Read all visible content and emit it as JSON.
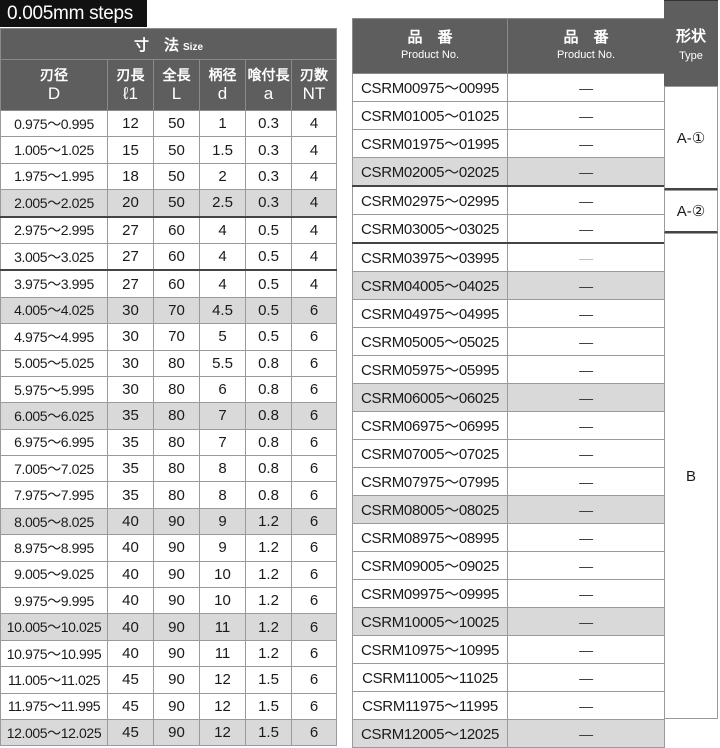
{
  "steps_label": "0.005mm steps",
  "size_table": {
    "group_header": {
      "jp": "寸　法",
      "en": "Size"
    },
    "columns": [
      {
        "jp": "刃径",
        "en": "D"
      },
      {
        "jp": "刃長",
        "en": "ℓ1"
      },
      {
        "jp": "全長",
        "en": "L"
      },
      {
        "jp": "柄径",
        "en": "d"
      },
      {
        "jp": "喰付長",
        "en": "a"
      },
      {
        "jp": "刃数",
        "en": "NT"
      }
    ],
    "rows": [
      {
        "D": "0.975～0.995",
        "l1": "12",
        "L": "50",
        "d": "1",
        "a": "0.3",
        "NT": "4",
        "shade": false,
        "group_end": false
      },
      {
        "D": "1.005～1.025",
        "l1": "15",
        "L": "50",
        "d": "1.5",
        "a": "0.3",
        "NT": "4",
        "shade": false,
        "group_end": false
      },
      {
        "D": "1.975～1.995",
        "l1": "18",
        "L": "50",
        "d": "2",
        "a": "0.3",
        "NT": "4",
        "shade": false,
        "group_end": false
      },
      {
        "D": "2.005～2.025",
        "l1": "20",
        "L": "50",
        "d": "2.5",
        "a": "0.3",
        "NT": "4",
        "shade": true,
        "group_end": true
      },
      {
        "D": "2.975～2.995",
        "l1": "27",
        "L": "60",
        "d": "4",
        "a": "0.5",
        "NT": "4",
        "shade": false,
        "group_end": false
      },
      {
        "D": "3.005～3.025",
        "l1": "27",
        "L": "60",
        "d": "4",
        "a": "0.5",
        "NT": "4",
        "shade": false,
        "group_end": true
      },
      {
        "D": "3.975～3.995",
        "l1": "27",
        "L": "60",
        "d": "4",
        "a": "0.5",
        "NT": "4",
        "shade": false,
        "group_end": false
      },
      {
        "D": "4.005～4.025",
        "l1": "30",
        "L": "70",
        "d": "4.5",
        "a": "0.5",
        "NT": "6",
        "shade": true,
        "group_end": false
      },
      {
        "D": "4.975～4.995",
        "l1": "30",
        "L": "70",
        "d": "5",
        "a": "0.5",
        "NT": "6",
        "shade": false,
        "group_end": false
      },
      {
        "D": "5.005～5.025",
        "l1": "30",
        "L": "80",
        "d": "5.5",
        "a": "0.8",
        "NT": "6",
        "shade": false,
        "group_end": false
      },
      {
        "D": "5.975～5.995",
        "l1": "30",
        "L": "80",
        "d": "6",
        "a": "0.8",
        "NT": "6",
        "shade": false,
        "group_end": false
      },
      {
        "D": "6.005～6.025",
        "l1": "35",
        "L": "80",
        "d": "7",
        "a": "0.8",
        "NT": "6",
        "shade": true,
        "group_end": false
      },
      {
        "D": "6.975～6.995",
        "l1": "35",
        "L": "80",
        "d": "7",
        "a": "0.8",
        "NT": "6",
        "shade": false,
        "group_end": false
      },
      {
        "D": "7.005～7.025",
        "l1": "35",
        "L": "80",
        "d": "8",
        "a": "0.8",
        "NT": "6",
        "shade": false,
        "group_end": false
      },
      {
        "D": "7.975～7.995",
        "l1": "35",
        "L": "80",
        "d": "8",
        "a": "0.8",
        "NT": "6",
        "shade": false,
        "group_end": false
      },
      {
        "D": "8.005～8.025",
        "l1": "40",
        "L": "90",
        "d": "9",
        "a": "1.2",
        "NT": "6",
        "shade": true,
        "group_end": false
      },
      {
        "D": "8.975～8.995",
        "l1": "40",
        "L": "90",
        "d": "9",
        "a": "1.2",
        "NT": "6",
        "shade": false,
        "group_end": false
      },
      {
        "D": "9.005～9.025",
        "l1": "40",
        "L": "90",
        "d": "10",
        "a": "1.2",
        "NT": "6",
        "shade": false,
        "group_end": false
      },
      {
        "D": "9.975～9.995",
        "l1": "40",
        "L": "90",
        "d": "10",
        "a": "1.2",
        "NT": "6",
        "shade": false,
        "group_end": false
      },
      {
        "D": "10.005～10.025",
        "l1": "40",
        "L": "90",
        "d": "11",
        "a": "1.2",
        "NT": "6",
        "shade": true,
        "group_end": false
      },
      {
        "D": "10.975～10.995",
        "l1": "40",
        "L": "90",
        "d": "11",
        "a": "1.2",
        "NT": "6",
        "shade": false,
        "group_end": false
      },
      {
        "D": "11.005～11.025",
        "l1": "45",
        "L": "90",
        "d": "12",
        "a": "1.5",
        "NT": "6",
        "shade": false,
        "group_end": false
      },
      {
        "D": "11.975～11.995",
        "l1": "45",
        "L": "90",
        "d": "12",
        "a": "1.5",
        "NT": "6",
        "shade": false,
        "group_end": false
      },
      {
        "D": "12.005～12.025",
        "l1": "45",
        "L": "90",
        "d": "12",
        "a": "1.5",
        "NT": "6",
        "shade": true,
        "group_end": false
      }
    ]
  },
  "product_table": {
    "columns": [
      {
        "jp": "品　番",
        "en": "Product No."
      },
      {
        "jp": "品　番",
        "en": "Product No."
      }
    ],
    "rows": [
      {
        "no1": "CSRM00975～00995",
        "no2": "—",
        "shade": false,
        "group_end": false,
        "faint": false
      },
      {
        "no1": "CSRM01005～01025",
        "no2": "—",
        "shade": false,
        "group_end": false,
        "faint": false
      },
      {
        "no1": "CSRM01975～01995",
        "no2": "—",
        "shade": false,
        "group_end": false,
        "faint": false
      },
      {
        "no1": "CSRM02005～02025",
        "no2": "—",
        "shade": true,
        "group_end": true,
        "faint": false
      },
      {
        "no1": "CSRM02975～02995",
        "no2": "—",
        "shade": false,
        "group_end": false,
        "faint": false
      },
      {
        "no1": "CSRM03005～03025",
        "no2": "—",
        "shade": false,
        "group_end": true,
        "faint": false
      },
      {
        "no1": "CSRM03975～03995",
        "no2": "—",
        "shade": false,
        "group_end": false,
        "faint": true
      },
      {
        "no1": "CSRM04005～04025",
        "no2": "—",
        "shade": true,
        "group_end": false,
        "faint": false
      },
      {
        "no1": "CSRM04975～04995",
        "no2": "—",
        "shade": false,
        "group_end": false,
        "faint": false
      },
      {
        "no1": "CSRM05005～05025",
        "no2": "—",
        "shade": false,
        "group_end": false,
        "faint": false
      },
      {
        "no1": "CSRM05975～05995",
        "no2": "—",
        "shade": false,
        "group_end": false,
        "faint": false
      },
      {
        "no1": "CSRM06005～06025",
        "no2": "—",
        "shade": true,
        "group_end": false,
        "faint": false
      },
      {
        "no1": "CSRM06975～06995",
        "no2": "—",
        "shade": false,
        "group_end": false,
        "faint": false
      },
      {
        "no1": "CSRM07005～07025",
        "no2": "—",
        "shade": false,
        "group_end": false,
        "faint": false
      },
      {
        "no1": "CSRM07975～07995",
        "no2": "—",
        "shade": false,
        "group_end": false,
        "faint": false
      },
      {
        "no1": "CSRM08005～08025",
        "no2": "—",
        "shade": true,
        "group_end": false,
        "faint": false
      },
      {
        "no1": "CSRM08975～08995",
        "no2": "—",
        "shade": false,
        "group_end": false,
        "faint": false
      },
      {
        "no1": "CSRM09005～09025",
        "no2": "—",
        "shade": false,
        "group_end": false,
        "faint": false
      },
      {
        "no1": "CSRM09975～09995",
        "no2": "—",
        "shade": false,
        "group_end": false,
        "faint": false
      },
      {
        "no1": "CSRM10005～10025",
        "no2": "—",
        "shade": true,
        "group_end": false,
        "faint": false
      },
      {
        "no1": "CSRM10975～10995",
        "no2": "—",
        "shade": false,
        "group_end": false,
        "faint": false
      },
      {
        "no1": "CSRM11005～11025",
        "no2": "—",
        "shade": false,
        "group_end": false,
        "faint": false
      },
      {
        "no1": "CSRM11975～11995",
        "no2": "—",
        "shade": false,
        "group_end": false,
        "faint": false
      },
      {
        "no1": "CSRM12005～12025",
        "no2": "—",
        "shade": true,
        "group_end": false,
        "faint": false
      }
    ]
  },
  "type_column": {
    "header": {
      "jp": "形状",
      "en": "Type"
    },
    "groups": [
      "A-①",
      "A-②",
      "B"
    ]
  },
  "colors": {
    "header_bg": "#5e5e5e",
    "shade_row": "#d9d9d9",
    "tab_bg": "#111111"
  }
}
